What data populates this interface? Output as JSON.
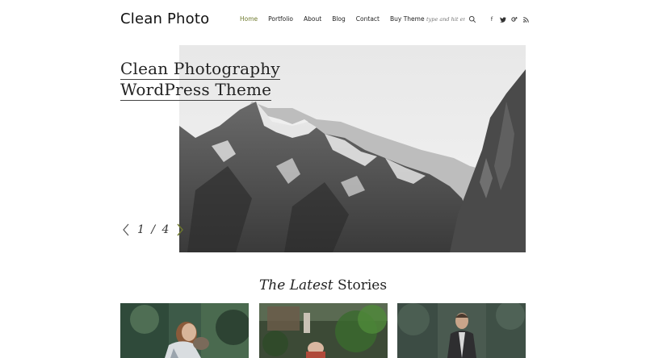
{
  "site": {
    "logo": "Clean Photo"
  },
  "nav": [
    {
      "label": "Home"
    },
    {
      "label": "Portfolio"
    },
    {
      "label": "About"
    },
    {
      "label": "Blog"
    },
    {
      "label": "Contact"
    },
    {
      "label": "Buy Theme"
    }
  ],
  "search": {
    "placeholder": "type and hit enter"
  },
  "social": [
    {
      "icon": "facebook-icon",
      "glyph": "f"
    },
    {
      "icon": "twitter-icon",
      "glyph": "t"
    },
    {
      "icon": "google-plus-icon",
      "glyph": "g+"
    },
    {
      "icon": "rss-icon",
      "glyph": "rss"
    }
  ],
  "hero": {
    "title_line1": "Clean Photography",
    "title_line2": "WordPress Theme",
    "current": "1",
    "separator": "/",
    "total": "4"
  },
  "latest": {
    "emphasis": "The Latest",
    "rest": "Stories"
  },
  "colors": {
    "accent": "#6f7a2e",
    "text": "#222222",
    "background": "#ffffff"
  }
}
